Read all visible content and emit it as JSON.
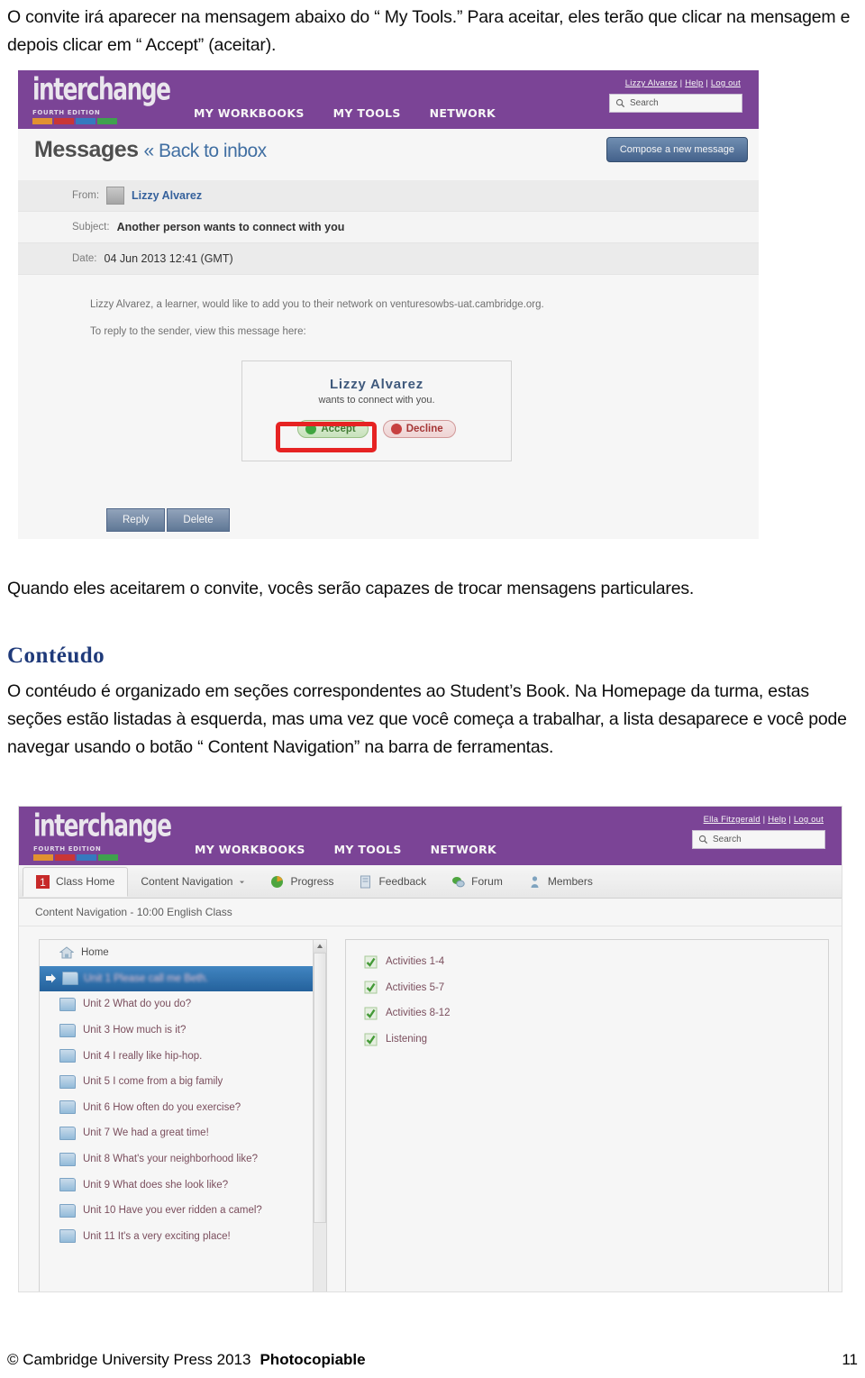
{
  "document": {
    "intro_paragraph": "O convite irá aparecer na mensagem abaixo do “ My Tools.”  Para aceitar, eles terão que clicar na mensagem e depois clicar em “ Accept” (aceitar).",
    "mid_paragraph": "Quando eles aceitarem o convite, vocês serão capazes de trocar mensagens particulares.",
    "section_heading": "Contéudo",
    "content_paragraph": "O contéudo é organizado em seções correspondentes ao Student’s Book. Na Homepage da turma, estas seções estão listadas à esquerda, mas uma vez que você começa a trabalhar, a lista desaparece e você pode navegar usando o botão “ Content Navigation”  na barra de ferramentas.",
    "footer": {
      "copyright": "© Cambridge University Press 2013",
      "photocopiable": "Photocopiable",
      "page_number": "11"
    }
  },
  "screenshot_messages": {
    "header": {
      "logo_word": "interchange",
      "logo_sub": "FOURTH EDITION",
      "nav": [
        "MY WORKBOOKS",
        "MY TOOLS",
        "NETWORK"
      ],
      "user_name": "Lizzy Alvarez",
      "help_label": "Help",
      "logout_label": "Log out",
      "search_placeholder": "Search"
    },
    "page_title": "Messages",
    "back_link": "« Back to inbox",
    "compose_button": "Compose a new message",
    "fields": [
      {
        "label": "From:",
        "value": "Lizzy Alvarez"
      },
      {
        "label": "Subject:",
        "value": "Another person wants to connect with you"
      },
      {
        "label": "Date:",
        "value": "04 Jun 2013 12:41 (GMT)"
      }
    ],
    "body_line_1": "Lizzy Alvarez, a learner, would like to add you to their network on venturesowbs-uat.cambridge.org.",
    "body_line_2": "To reply to the sender, view this message here:",
    "connect_card": {
      "name": "Lizzy Alvarez",
      "subtitle": "wants to connect with you.",
      "accept_label": "Accept",
      "decline_label": "Decline"
    },
    "actions": {
      "reply_label": "Reply",
      "delete_label": "Delete"
    }
  },
  "screenshot_content": {
    "header": {
      "logo_word": "interchange",
      "logo_sub": "FOURTH EDITION",
      "nav": [
        "MY WORKBOOKS",
        "MY TOOLS",
        "NETWORK"
      ],
      "user_name": "Ella Fitzgerald",
      "help_label": "Help",
      "logout_label": "Log out",
      "search_placeholder": "Search"
    },
    "toolbar": [
      {
        "label": "Class Home",
        "icon": "number-one-icon"
      },
      {
        "label": "Content Navigation",
        "icon": "chevron-down-icon"
      },
      {
        "label": "Progress",
        "icon": "pie-chart-icon"
      },
      {
        "label": "Feedback",
        "icon": "document-icon"
      },
      {
        "label": "Forum",
        "icon": "speech-bubble-icon"
      },
      {
        "label": "Members",
        "icon": "person-icon"
      }
    ],
    "subbar_title": "Content Navigation - 10:00 English Class",
    "tree_items": [
      {
        "label": "Home",
        "selected": false,
        "icon": "home-icon"
      },
      {
        "label": "Unit 1 Please call me Beth.",
        "selected": true,
        "icon": "folder-icon"
      },
      {
        "label": "Unit 2 What do you do?",
        "selected": false,
        "icon": "folder-icon"
      },
      {
        "label": "Unit 3 How much is it?",
        "selected": false,
        "icon": "folder-icon"
      },
      {
        "label": "Unit 4 I really like hip-hop.",
        "selected": false,
        "icon": "folder-icon"
      },
      {
        "label": "Unit 5 I come from a big family",
        "selected": false,
        "icon": "folder-icon"
      },
      {
        "label": "Unit 6 How often do you exercise?",
        "selected": false,
        "icon": "folder-icon"
      },
      {
        "label": "Unit 7 We had a great time!",
        "selected": false,
        "icon": "folder-icon"
      },
      {
        "label": "Unit 8 What's your neighborhood like?",
        "selected": false,
        "icon": "folder-icon"
      },
      {
        "label": "Unit 9 What does she look like?",
        "selected": false,
        "icon": "folder-icon"
      },
      {
        "label": "Unit 10 Have you ever ridden a camel?",
        "selected": false,
        "icon": "folder-icon"
      },
      {
        "label": "Unit 11 It's a very exciting place!",
        "selected": false,
        "icon": "folder-icon"
      }
    ],
    "activity_items": [
      {
        "label": "Activities 1-4",
        "icon": "check-icon"
      },
      {
        "label": "Activities 5-7",
        "icon": "check-icon"
      },
      {
        "label": "Activities 8-12",
        "icon": "check-icon"
      },
      {
        "label": "Listening",
        "icon": "check-icon"
      }
    ]
  },
  "colors": {
    "brand_purple": "#7b3f98",
    "heading_navy": "#1f3a7a",
    "selection_blue": "#1d5f9e",
    "accept_green": "#3aa83a",
    "decline_red": "#cc3b3b",
    "highlight_red": "#ee1c1c"
  }
}
